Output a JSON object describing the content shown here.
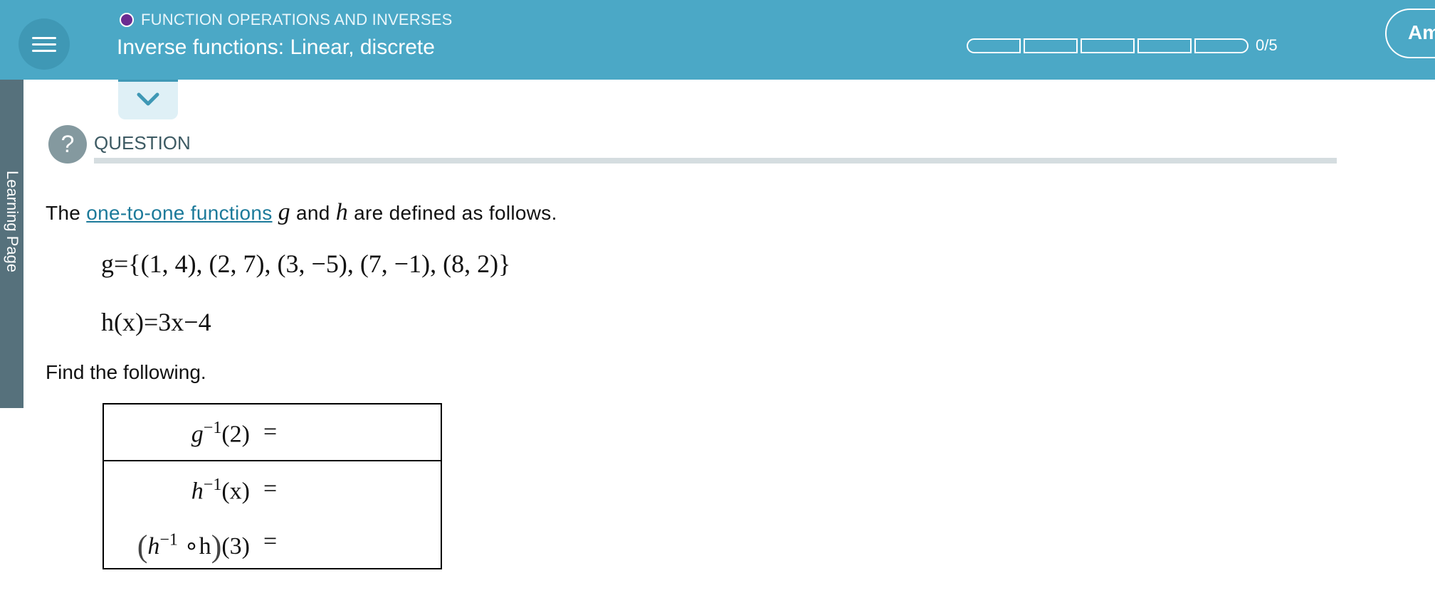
{
  "header": {
    "topic": "FUNCTION OPERATIONS AND INVERSES",
    "title": "Inverse functions: Linear, discrete",
    "progress_text": "0/5",
    "progress_segments": 5,
    "progress_completed": 0,
    "account_label": "Am",
    "colors": {
      "bar": "#4ba8c6",
      "topic_dot": "#6b2c91"
    }
  },
  "sidebar": {
    "label": "Learning Page"
  },
  "question": {
    "label": "QUESTION",
    "intro_before": "The",
    "intro_link": "one-to-one functions",
    "intro_g": "g",
    "intro_and": "and",
    "intro_h": "h",
    "intro_after": "are defined as follows.",
    "g_definition": "g={(1, 4), (2, 7), (3, −5), (7, −1), (8, 2)}",
    "h_definition": "h(x)=3x−4",
    "find_text": "Find the following.",
    "rows": [
      {
        "expr_main": "g",
        "expr_sup": "−1",
        "expr_arg": "(2)",
        "equals": "="
      },
      {
        "expr_main": "h",
        "expr_sup": "−1",
        "expr_arg": "(x)",
        "equals": "="
      },
      {
        "expr_main": "h",
        "expr_sup": "−1",
        "expr_comp": "∘h",
        "expr_arg": "(3)",
        "equals": "="
      }
    ]
  }
}
